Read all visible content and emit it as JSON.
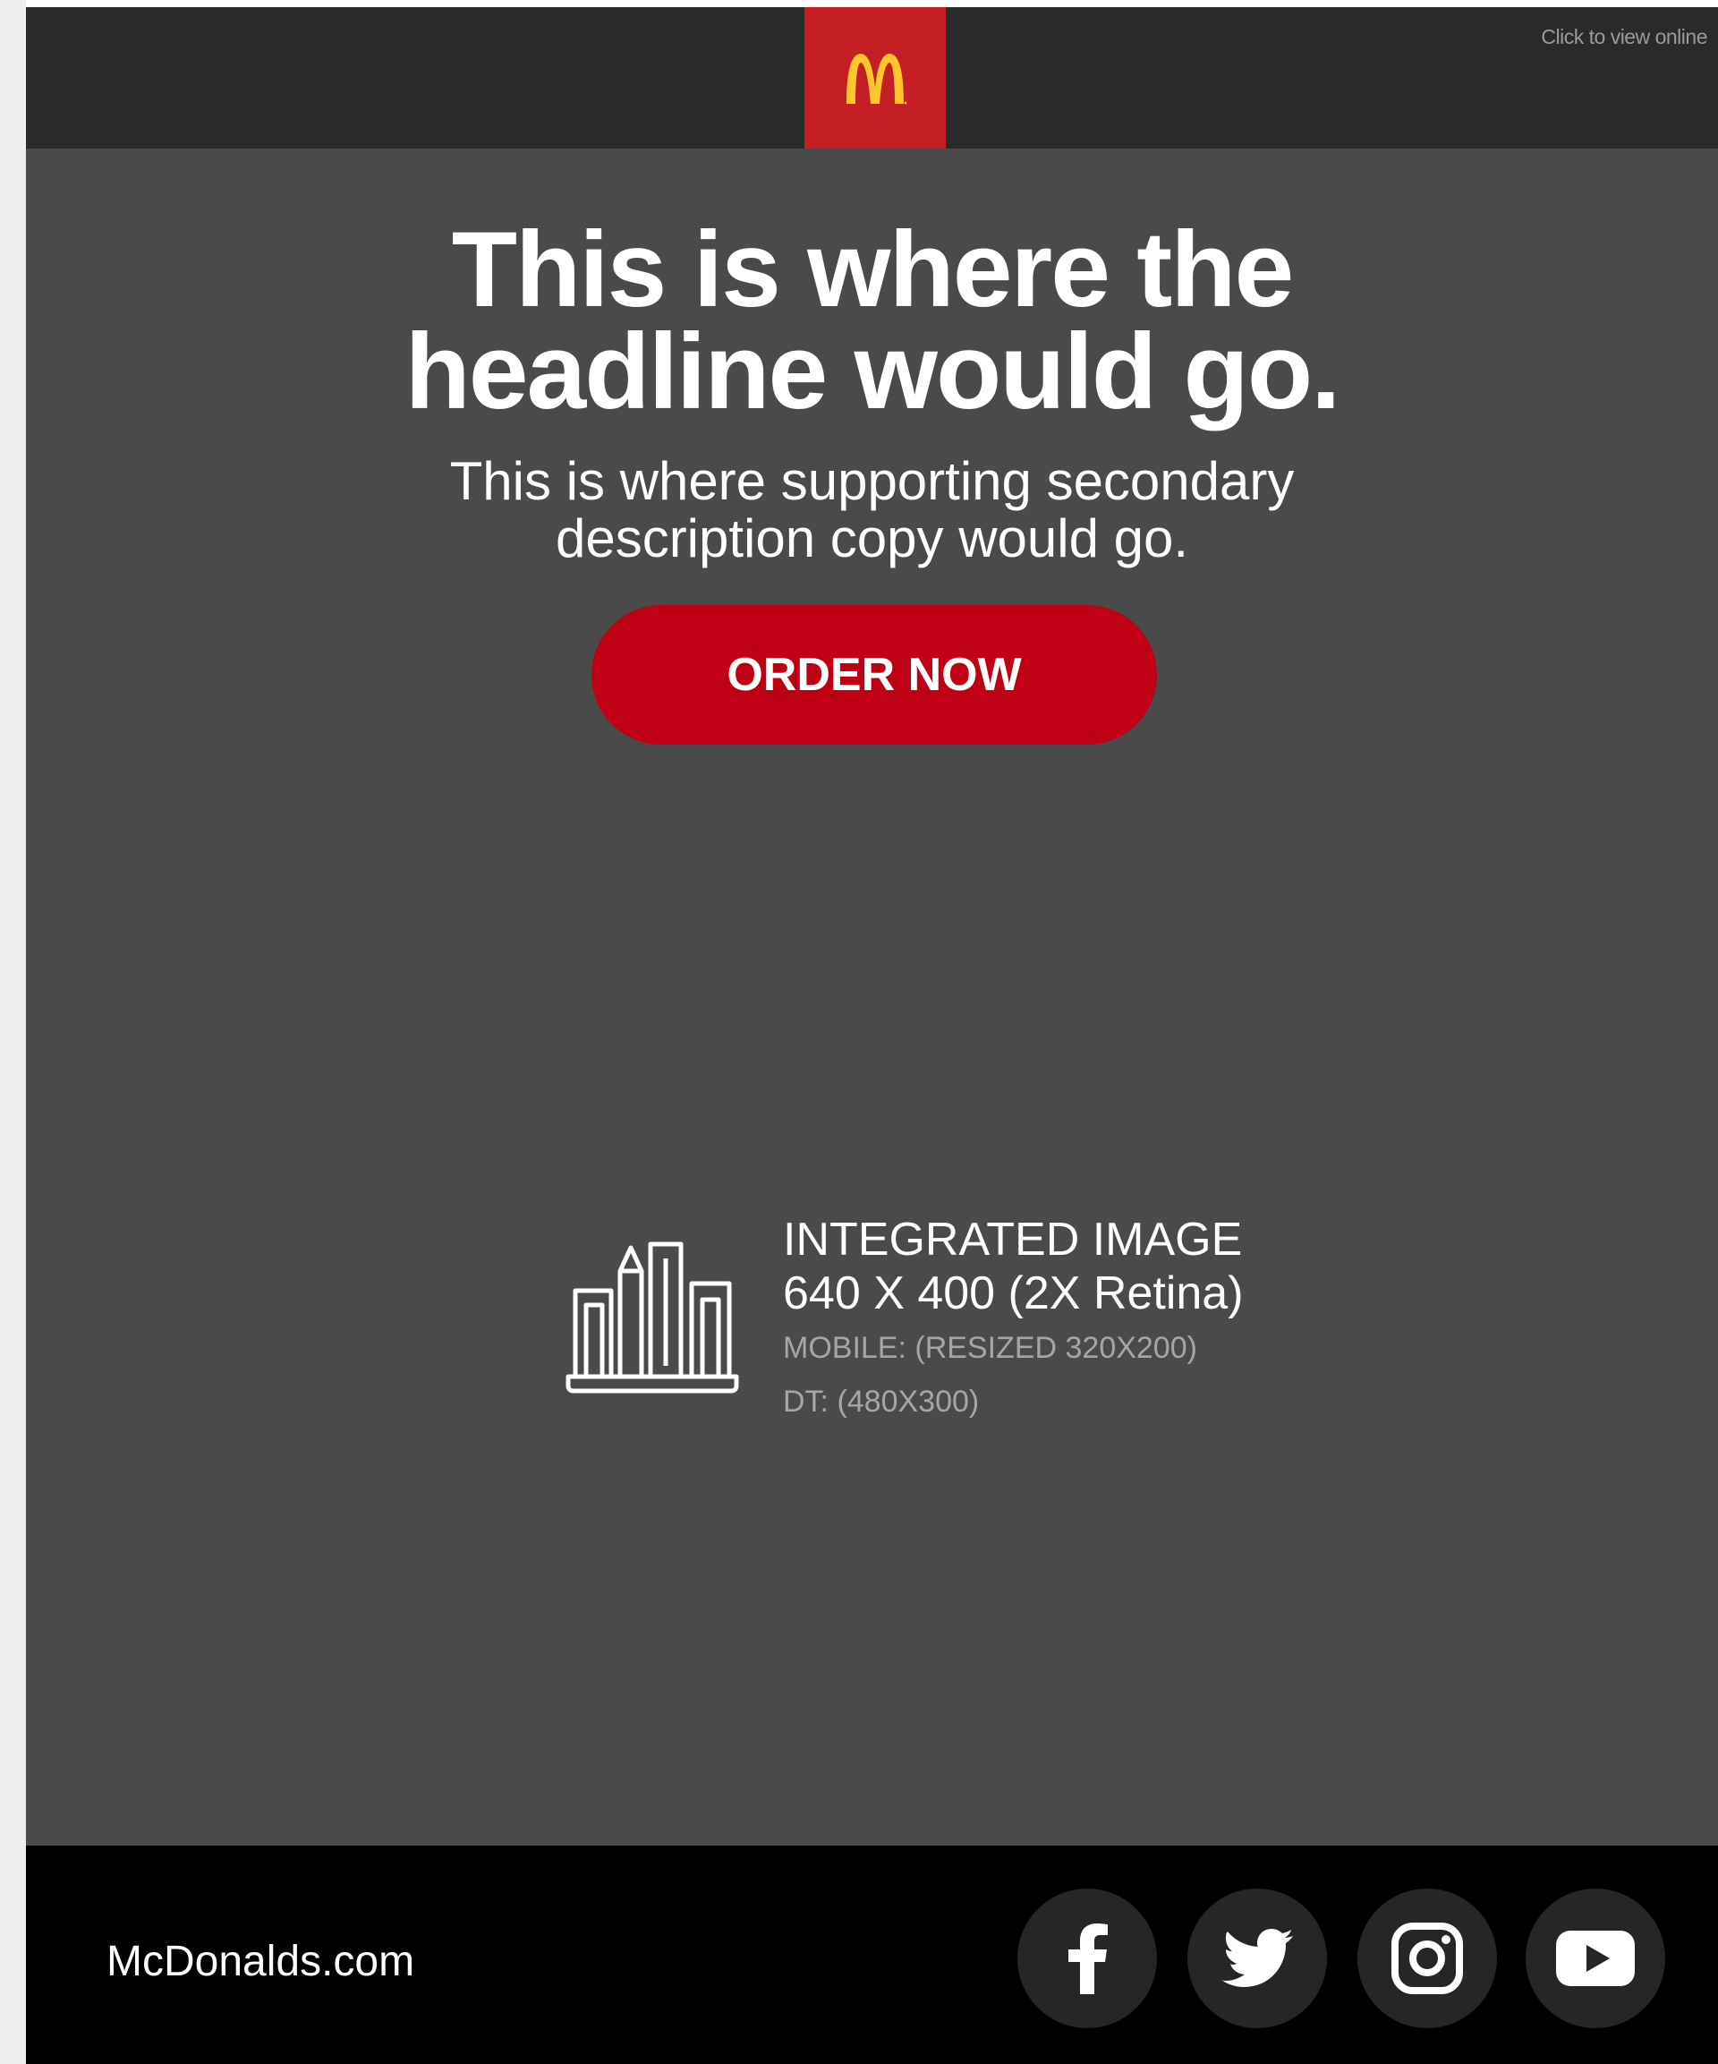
{
  "header": {
    "view_online": "Click to view online",
    "logo_icon": "mcdonalds-golden-arches-icon",
    "logo_bg_color": "#c41f24",
    "arches_color": "#ffc72c"
  },
  "hero": {
    "headline_line1": "This is where the",
    "headline_line2": "headline would go.",
    "subcopy_line1": "This is where supporting secondary",
    "subcopy_line2": "description copy would go.",
    "cta_label": "ORDER NOW",
    "cta_color": "#bf0014",
    "placeholder": {
      "icon": "buildings-laptop-icon",
      "title": "INTEGRATED IMAGE",
      "size": "640 X 400 (2X Retina)",
      "mobile": "MOBILE: (RESIZED 320X200)",
      "desktop": "DT: (480X300)"
    }
  },
  "footer": {
    "site": "McDonalds.com",
    "social": [
      {
        "name": "facebook",
        "icon": "facebook-icon"
      },
      {
        "name": "twitter",
        "icon": "twitter-icon"
      },
      {
        "name": "instagram",
        "icon": "instagram-icon"
      },
      {
        "name": "youtube",
        "icon": "youtube-icon"
      }
    ]
  }
}
